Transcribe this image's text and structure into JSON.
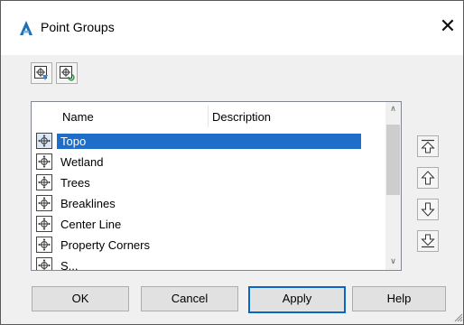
{
  "dialog": {
    "title": "Point Groups",
    "close_glyph": "✕"
  },
  "toolbar": [
    {
      "name": "point-group-properties-button",
      "icon": "point-group-properties-icon"
    },
    {
      "name": "update-point-groups-button",
      "icon": "update-point-groups-icon"
    }
  ],
  "list": {
    "columns": {
      "name": "Name",
      "description": "Description"
    },
    "items": [
      {
        "name": "Topo",
        "description": "",
        "selected": true
      },
      {
        "name": "Wetland",
        "description": ""
      },
      {
        "name": "Trees",
        "description": ""
      },
      {
        "name": "Breaklines",
        "description": ""
      },
      {
        "name": "Center Line",
        "description": ""
      },
      {
        "name": "Property Corners",
        "description": ""
      },
      {
        "name": "S...",
        "description": ""
      }
    ]
  },
  "move_buttons": [
    "move-to-top",
    "move-up",
    "move-down",
    "move-to-bottom"
  ],
  "buttons": {
    "ok": "OK",
    "cancel": "Cancel",
    "apply": "Apply",
    "help": "Help"
  },
  "colors": {
    "selection": "#1e6ec9",
    "default_button_border": "#0a66c8",
    "app_icon": "#1f6fb5"
  }
}
